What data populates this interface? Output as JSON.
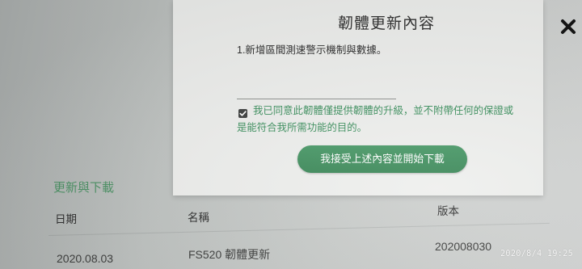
{
  "dialog": {
    "title": "韌體更新內容",
    "content": "1.新增區間測速警示機制與數據。",
    "agree_checked": true,
    "agree_line1": "我已同意此韌體僅提供韌體的升級，並不附帶任何的保證或",
    "agree_line2": "是能符合我所需功能的目的。",
    "accept_button": "我接受上述內容並開始下載",
    "close_icon": "close-icon",
    "checkbox_icon": "checkbox-checked-icon"
  },
  "section": {
    "title": "更新與下載"
  },
  "table": {
    "headers": [
      "日期",
      "名稱",
      "版本"
    ],
    "rows": [
      [
        "2020.08.03",
        "FS520 韌體更新",
        "202008030"
      ]
    ]
  },
  "photo_timestamp": "2020/8/4 19:25",
  "colors": {
    "accent": "#3f8e5c",
    "agree_text": "#3b8f5d",
    "dialog_bg": "#eeefed",
    "text_dark": "#2d2d2d"
  }
}
